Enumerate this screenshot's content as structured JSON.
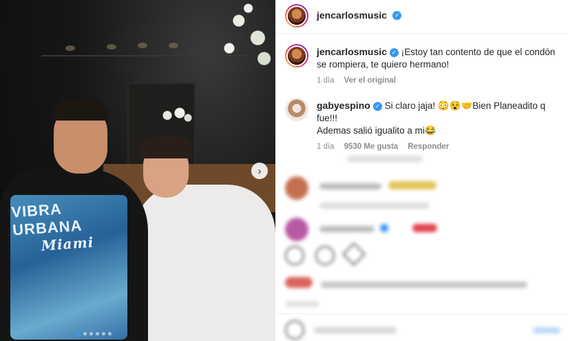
{
  "post": {
    "author": "jencarlosmusic",
    "author_verified": true,
    "caption_prefix": "¡Estoy tan contento de que el condón se rompiera, te quiero hermano!",
    "caption_age": "1 día",
    "see_original": "Ver el original"
  },
  "photo": {
    "shirt_text_top": "VIBRA URBANA",
    "shirt_text_script": "Miami",
    "carousel_total": 6,
    "carousel_active": 0
  },
  "comments": [
    {
      "username": "gabyespino",
      "verified": true,
      "text_line1": "Si claro jaja! 😳😵🤝Bien Planeadito q fue!!!",
      "text_line2": "Ademas salió igualito a mi😂",
      "age": "1 día",
      "likes": "9530 Me gusta",
      "reply": "Responder"
    }
  ],
  "colors": {
    "accent": "#3897f0",
    "text": "#262626",
    "muted": "#8e8e8e"
  },
  "icons": [
    "verified-icon",
    "chevron-right-icon",
    "heart-icon",
    "comment-icon",
    "share-icon",
    "emoji-icon"
  ]
}
